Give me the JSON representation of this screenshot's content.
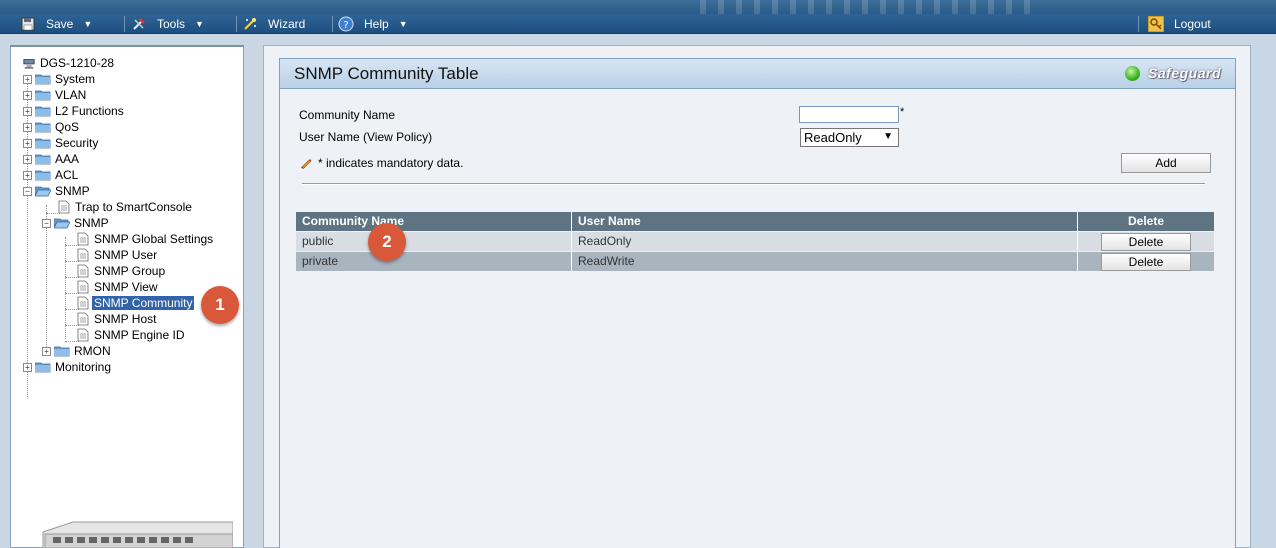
{
  "menubar": {
    "save_label": "Save",
    "tools_label": "Tools",
    "wizard_label": "Wizard",
    "help_label": "Help",
    "logout_label": "Logout"
  },
  "tree": {
    "root": "DGS-1210-28",
    "system": "System",
    "vlan": "VLAN",
    "l2": "L2 Functions",
    "qos": "QoS",
    "security": "Security",
    "aaa": "AAA",
    "acl": "ACL",
    "snmp": "SNMP",
    "trap": "Trap to SmartConsole",
    "snmp_sub": "SNMP",
    "global": "SNMP Global Settings",
    "user": "SNMP User",
    "group": "SNMP Group",
    "view": "SNMP View",
    "community": "SNMP Community",
    "host": "SNMP Host",
    "engine": "SNMP Engine ID",
    "rmon": "RMON",
    "monitoring": "Monitoring"
  },
  "callouts": {
    "one": "1",
    "two": "2"
  },
  "panel": {
    "title": "SNMP Community Table",
    "safeguard": "Safeguard",
    "community_name_label": "Community Name",
    "community_name_value": "",
    "required_mark": "*",
    "user_name_label": "User Name (View Policy)",
    "user_name_value": "ReadOnly",
    "mandatory_note": "* indicates mandatory data.",
    "add_label": "Add"
  },
  "table": {
    "headers": {
      "community": "Community Name",
      "user": "User Name",
      "delete": "Delete"
    },
    "rows": [
      {
        "community": "public",
        "user": "ReadOnly",
        "action": "Delete"
      },
      {
        "community": "private",
        "user": "ReadWrite",
        "action": "Delete"
      }
    ]
  },
  "colors": {
    "accent": "#3164a8",
    "callout": "#d9583a",
    "table_header": "#5f7482"
  }
}
